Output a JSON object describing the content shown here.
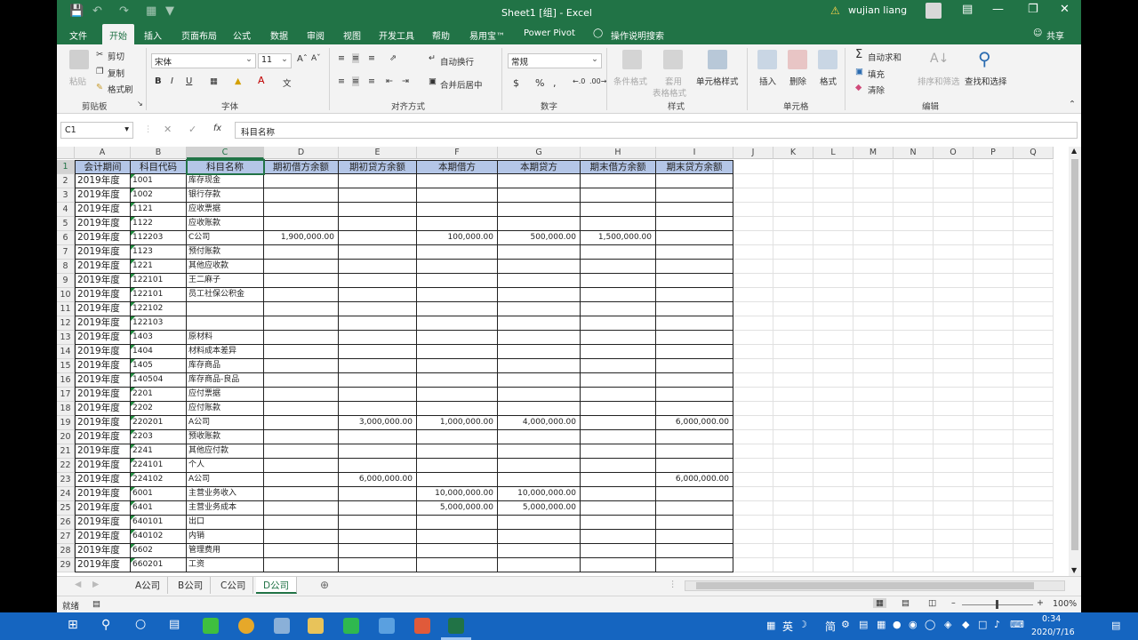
{
  "title": {
    "doc": "Sheet1 [组] - Excel",
    "user": "wujian liang",
    "share": "共享",
    "tell_me": "操作说明搜索"
  },
  "tabs": [
    "文件",
    "开始",
    "插入",
    "页面布局",
    "公式",
    "数据",
    "审阅",
    "视图",
    "开发工具",
    "帮助",
    "易用宝™",
    "Power Pivot"
  ],
  "ribbon": {
    "clipboard": {
      "label": "剪贴板",
      "paste": "粘贴",
      "cut": "剪切",
      "copy": "复制",
      "format_painter": "格式刷"
    },
    "font": {
      "label": "字体",
      "name": "宋体",
      "size": "11"
    },
    "align": {
      "label": "对齐方式",
      "wrap": "自动换行",
      "merge": "合并后居中"
    },
    "number": {
      "label": "数字",
      "format": "常规"
    },
    "styles": {
      "label": "样式",
      "cond": "条件格式",
      "table": "套用",
      "table2": "表格格式",
      "cell": "单元格样式"
    },
    "cells": {
      "label": "单元格",
      "insert": "插入",
      "delete": "删除",
      "format": "格式"
    },
    "editing": {
      "label": "编辑",
      "autosum": "自动求和",
      "fill": "填充",
      "clear": "清除",
      "sort": "排序和筛选",
      "find": "查找和选择"
    }
  },
  "formula_bar": {
    "name_box": "C1",
    "fx": "fx",
    "content": "科目名称"
  },
  "columns": [
    "A",
    "B",
    "C",
    "D",
    "E",
    "F",
    "G",
    "H",
    "I",
    "J",
    "K",
    "L",
    "M",
    "N",
    "O",
    "P",
    "Q"
  ],
  "headers": [
    "会计期间",
    "科目代码",
    "科目名称",
    "期初借方余额",
    "期初贷方余额",
    "本期借方",
    "本期贷方",
    "期末借方余额",
    "期末贷方余额"
  ],
  "rows": [
    [
      "2019年度",
      "1001",
      "库存现金",
      "",
      "",
      "",
      "",
      "",
      ""
    ],
    [
      "2019年度",
      "1002",
      "银行存款",
      "",
      "",
      "",
      "",
      "",
      ""
    ],
    [
      "2019年度",
      "1121",
      "应收票据",
      "",
      "",
      "",
      "",
      "",
      ""
    ],
    [
      "2019年度",
      "1122",
      "应收账款",
      "",
      "",
      "",
      "",
      "",
      ""
    ],
    [
      "2019年度",
      "112203",
      "C公司",
      "1,900,000.00",
      "",
      "100,000.00",
      "500,000.00",
      "1,500,000.00",
      ""
    ],
    [
      "2019年度",
      "1123",
      "预付账款",
      "",
      "",
      "",
      "",
      "",
      ""
    ],
    [
      "2019年度",
      "1221",
      "其他应收款",
      "",
      "",
      "",
      "",
      "",
      ""
    ],
    [
      "2019年度",
      "122101",
      "王二麻子",
      "",
      "",
      "",
      "",
      "",
      ""
    ],
    [
      "2019年度",
      "122101",
      "员工社保公积金",
      "",
      "",
      "",
      "",
      "",
      ""
    ],
    [
      "2019年度",
      "122102",
      "",
      "",
      "",
      "",
      "",
      "",
      ""
    ],
    [
      "2019年度",
      "122103",
      "",
      "",
      "",
      "",
      "",
      "",
      ""
    ],
    [
      "2019年度",
      "1403",
      "原材料",
      "",
      "",
      "",
      "",
      "",
      ""
    ],
    [
      "2019年度",
      "1404",
      "材料成本差异",
      "",
      "",
      "",
      "",
      "",
      ""
    ],
    [
      "2019年度",
      "1405",
      "库存商品",
      "",
      "",
      "",
      "",
      "",
      ""
    ],
    [
      "2019年度",
      "140504",
      "      库存商品-良品",
      "",
      "",
      "",
      "",
      "",
      ""
    ],
    [
      "2019年度",
      "2201",
      "应付票据",
      "",
      "",
      "",
      "",
      "",
      ""
    ],
    [
      "2019年度",
      "2202",
      "应付账款",
      "",
      "",
      "",
      "",
      "",
      ""
    ],
    [
      "2019年度",
      "220201",
      "A公司",
      "",
      "3,000,000.00",
      "1,000,000.00",
      "4,000,000.00",
      "",
      "6,000,000.00"
    ],
    [
      "2019年度",
      "2203",
      "预收账款",
      "",
      "",
      "",
      "",
      "",
      ""
    ],
    [
      "2019年度",
      "2241",
      "其他应付款",
      "",
      "",
      "",
      "",
      "",
      ""
    ],
    [
      "2019年度",
      "224101",
      "      个人",
      "",
      "",
      "",
      "",
      "",
      ""
    ],
    [
      "2019年度",
      "224102",
      "A公司",
      "",
      "6,000,000.00",
      "",
      "",
      "",
      "6,000,000.00"
    ],
    [
      "2019年度",
      "6001",
      "主营业务收入",
      "",
      "",
      "10,000,000.00",
      "10,000,000.00",
      "",
      ""
    ],
    [
      "2019年度",
      "6401",
      "主营业务成本",
      "",
      "",
      "5,000,000.00",
      "5,000,000.00",
      "",
      ""
    ],
    [
      "2019年度",
      "640101",
      "      出口",
      "",
      "",
      "",
      "",
      "",
      ""
    ],
    [
      "2019年度",
      "640102",
      "      内销",
      "",
      "",
      "",
      "",
      "",
      ""
    ],
    [
      "2019年度",
      "6602",
      "管理费用",
      "",
      "",
      "",
      "",
      "",
      ""
    ],
    [
      "2019年度",
      "660201",
      "      工资",
      "",
      "",
      "",
      "",
      "",
      ""
    ]
  ],
  "sheets": [
    "A公司",
    "B公司",
    "C公司",
    "D公司"
  ],
  "status": {
    "ready": "就绪",
    "zoom": "100%"
  },
  "taskbar": {
    "ime": "英",
    "ime2": "简",
    "time": "0:34",
    "date": "2020/7/16"
  }
}
